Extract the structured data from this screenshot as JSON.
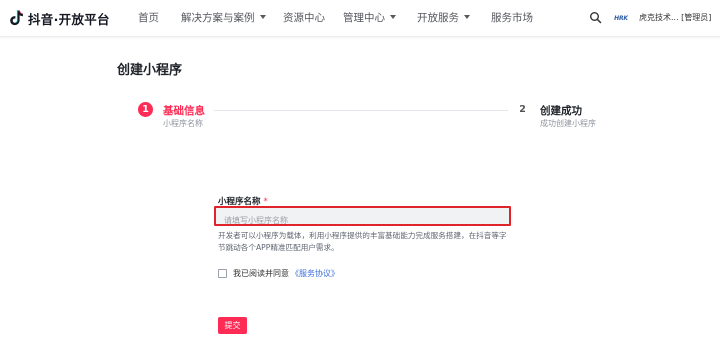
{
  "header": {
    "brand": "抖音·开放平台",
    "nav": [
      {
        "label": "首页",
        "has_dropdown": false
      },
      {
        "label": "解决方案与案例",
        "has_dropdown": true
      },
      {
        "label": "资源中心",
        "has_dropdown": false
      },
      {
        "label": "管理中心",
        "has_dropdown": true
      },
      {
        "label": "开放服务",
        "has_dropdown": true
      },
      {
        "label": "服务市场",
        "has_dropdown": false
      }
    ],
    "search_icon": "search-icon",
    "avatar_text": "HRK",
    "user_label": "虎克技术... [管理员]"
  },
  "page": {
    "title": "创建小程序"
  },
  "steps": [
    {
      "number": "1",
      "title": "基础信息",
      "desc": "小程序名称",
      "active": true
    },
    {
      "number": "2",
      "title": "创建成功",
      "desc": "成功创建小程序",
      "active": false
    }
  ],
  "form": {
    "name_label": "小程序名称",
    "required_mark": "*",
    "name_placeholder": "请填写小程序名称",
    "name_value": "",
    "help_text": "开发者可以小程序为载体，利用小程序提供的丰富基础能力完成服务搭建，在抖音等字节跳动各个APP精准匹配用户需求。",
    "agree_text": "我已阅读并同意",
    "agree_link": "《服务协议》",
    "agree_checked": false,
    "submit_label": "提交"
  },
  "colors": {
    "accent": "#fe2c55",
    "error_border": "#e0242c",
    "link": "#3a6fd8"
  }
}
